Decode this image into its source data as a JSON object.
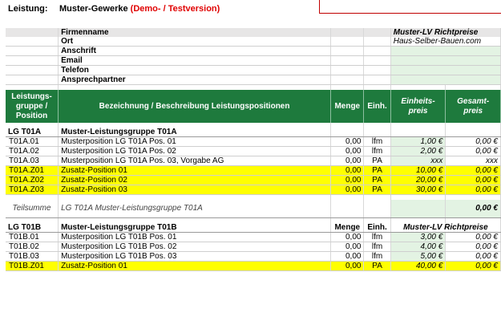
{
  "header": {
    "label": "Leistung:",
    "title": "Muster-Gewerke",
    "demo": "(Demo- / Testversion)"
  },
  "company": {
    "heading": "Firmenname",
    "rows": [
      "Ort",
      "Anschrift",
      "Email",
      "Telefon",
      "Ansprechpartner"
    ],
    "brand_title": "Muster-LV Richtpreise",
    "brand_url": "Haus-Selber-Bauen.com"
  },
  "columns": {
    "group": "Leistungs-gruppe / Position",
    "desc": "Bezeichnung / Beschreibung Leistungspositionen",
    "qty": "Menge",
    "unit": "Einh.",
    "unit_price": "Einheits-preis",
    "total": "Gesamt-preis"
  },
  "groupA": {
    "id": "LG T01A",
    "name": "Muster-Leistungsgruppe T01A",
    "rows": [
      {
        "pos": "T01A.01",
        "desc": "Musterposition LG T01A Pos. 01",
        "qty": "0,00",
        "unit": "lfm",
        "price": "1,00 €",
        "total": "0,00 €",
        "yellow": false
      },
      {
        "pos": "T01A.02",
        "desc": "Musterposition LG T01A Pos. 02",
        "qty": "0,00",
        "unit": "lfm",
        "price": "2,00 €",
        "total": "0,00 €",
        "yellow": false
      },
      {
        "pos": "T01A.03",
        "desc": "Musterposition LG T01A Pos. 03, Vorgabe AG",
        "qty": "0,00",
        "unit": "PA",
        "price": "xxx",
        "total": "xxx",
        "yellow": false
      },
      {
        "pos": "T01A.Z01",
        "desc": "Zusatz-Position 01",
        "qty": "0,00",
        "unit": "PA",
        "price": "10,00 €",
        "total": "0,00 €",
        "yellow": true
      },
      {
        "pos": "T01A.Z02",
        "desc": "Zusatz-Position 02",
        "qty": "0,00",
        "unit": "PA",
        "price": "20,00 €",
        "total": "0,00 €",
        "yellow": true
      },
      {
        "pos": "T01A.Z03",
        "desc": "Zusatz-Position 03",
        "qty": "0,00",
        "unit": "PA",
        "price": "30,00 €",
        "total": "0,00 €",
        "yellow": true
      }
    ],
    "subtotal_label": "Teilsumme",
    "subtotal_desc": "LG T01A Muster-Leistungsgruppe T01A",
    "subtotal_value": "0,00 €"
  },
  "groupB": {
    "id": "LG T01B",
    "name": "Muster-Leistungsgruppe T01B",
    "qty_hdr": "Menge",
    "unit_hdr": "Einh.",
    "brand": "Muster-LV Richtpreise",
    "rows": [
      {
        "pos": "T01B.01",
        "desc": "Musterposition LG T01B Pos. 01",
        "qty": "0,00",
        "unit": "lfm",
        "price": "3,00 €",
        "total": "0,00 €",
        "yellow": false
      },
      {
        "pos": "T01B.02",
        "desc": "Musterposition LG T01B Pos. 02",
        "qty": "0,00",
        "unit": "lfm",
        "price": "4,00 €",
        "total": "0,00 €",
        "yellow": false
      },
      {
        "pos": "T01B.03",
        "desc": "Musterposition LG T01B Pos. 03",
        "qty": "0,00",
        "unit": "lfm",
        "price": "5,00 €",
        "total": "0,00 €",
        "yellow": false
      },
      {
        "pos": "T01B.Z01",
        "desc": "Zusatz-Position 01",
        "qty": "0,00",
        "unit": "PA",
        "price": "40,00 €",
        "total": "0,00 €",
        "yellow": true
      }
    ]
  },
  "colors": {
    "header_green": "#1e7a3d",
    "light_green": "#e3f3e3",
    "highlight": "#ffff00",
    "demo_red": "#e00000"
  }
}
